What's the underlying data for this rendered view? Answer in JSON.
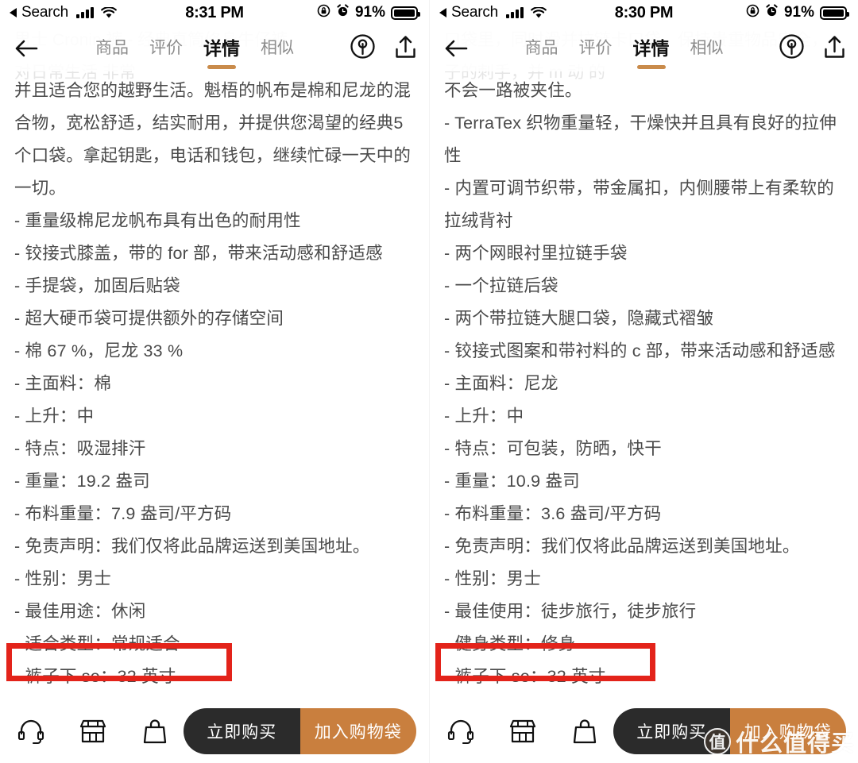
{
  "colors": {
    "accent_orange": "#c97f3e",
    "tab_underline": "#c98b4b",
    "highlight_red": "#e3231a",
    "buy_now_dark": "#2b2b2b",
    "body_text": "#4a4a4a"
  },
  "left": {
    "statusbar": {
      "carrier_label": "Search",
      "time": "8:31 PM",
      "battery_percent": "91%",
      "icons": [
        "back-triangle-icon",
        "cellular-signal-icon",
        "wifi-icon",
        "rotation-lock-icon",
        "alarm-clock-icon",
        "battery-icon"
      ]
    },
    "nav": {
      "back_icon": "back-arrow-icon",
      "tabs": [
        {
          "label": "商品",
          "active": false
        },
        {
          "label": "评价",
          "active": false
        },
        {
          "label": "详情",
          "active": true
        },
        {
          "label": "相似",
          "active": false
        }
      ],
      "right_icons": [
        "broadcast-icon",
        "share-icon"
      ]
    },
    "ghost_lines": [
      "男士 Cronin 裤 - 经典直筒修身牛仔裤",
      "对日常生活 非常"
    ],
    "body": {
      "paragraph": "并且适合您的越野生活。魁梧的帆布是棉和尼龙的混合物，宽松舒适，结实耐用，并提供您渴望的经典5个口袋。拿起钥匙，电话和钱包，继续忙碌一天中的一切。",
      "bullets": [
        "- 重量级棉尼龙帆布具有出色的耐用性",
        "- 铰接式膝盖，带的 for 部，带来活动感和舒适感",
        "- 手提袋，加固后贴袋",
        "- 超大硬币袋可提供额外的存储空间",
        "- 棉 67 %，尼龙 33 %",
        "- 主面料：棉",
        "- 上升：中",
        "- 特点：吸湿排汗",
        "- 重量：19.2 盎司",
        "- 布料重量：7.9 盎司/平方码",
        "- 免责声明：我们仅将此品牌运送到美国地址。",
        "- 性别：男士",
        "- 最佳用途：休闲"
      ],
      "highlighted_bullet": "- 适合类型：常规适合",
      "bullets_after": [
        "- 裤子下 se：32 英寸"
      ]
    },
    "bottombar": {
      "icons": [
        "headset-support-icon",
        "store-icon",
        "shopping-bag-icon"
      ],
      "buy_now_label": "立即购买",
      "add_to_cart_label": "加入购物袋"
    }
  },
  "right": {
    "statusbar": {
      "carrier_label": "Search",
      "time": "8:30 PM",
      "battery_percent": "91%",
      "icons": [
        "back-triangle-icon",
        "cellular-signal-icon",
        "wifi-icon",
        "rotation-lock-icon",
        "alarm-clock-icon",
        "battery-icon"
      ]
    },
    "nav": {
      "back_icon": "back-arrow-icon",
      "tabs": [
        {
          "label": "商品",
          "active": false
        },
        {
          "label": "评价",
          "active": false
        },
        {
          "label": "详情",
          "active": true
        },
        {
          "label": "相似",
          "active": false
        }
      ],
      "right_icons": [
        "broadcast-icon",
        "share-icon"
      ]
    },
    "ghost_lines": [
      "口袋里，同时滑并拉链卡口袋，保持贵重物品安全，",
      "子的刺手，并 m 动 的"
    ],
    "body": {
      "paragraph": "不会一路被夹住。",
      "bullets": [
        "- TerraTex 织物重量轻，干燥快并且具有良好的拉伸性",
        "- 内置可调节织带，带金属扣，内侧腰带上有柔软的拉绒背衬",
        "- 两个网眼衬里拉链手袋",
        "- 一个拉链后袋",
        "- 两个带拉链大腿口袋，隐藏式褶皱",
        "- 铰接式图案和带衬料的 c 部，带来活动感和舒适感",
        "- 主面料：尼龙",
        "- 上升：中",
        "- 特点：可包装，防晒，快干",
        "- 重量：10.9 盎司",
        "- 布料重量：3.6 盎司/平方码",
        "- 免责声明：我们仅将此品牌运送到美国地址。",
        "- 性别：男士",
        "- 最佳使用：徒步旅行，徒步旅行"
      ],
      "highlighted_bullet": "- 健身类型：修身",
      "bullets_after": [
        "- 裤子下 se：32 英寸"
      ]
    },
    "bottombar": {
      "icons": [
        "headset-support-icon",
        "store-icon",
        "shopping-bag-icon"
      ],
      "buy_now_label": "立即购买",
      "add_to_cart_label": "加入购物袋"
    }
  },
  "watermark": {
    "badge": "值",
    "text": "什么值得买"
  }
}
